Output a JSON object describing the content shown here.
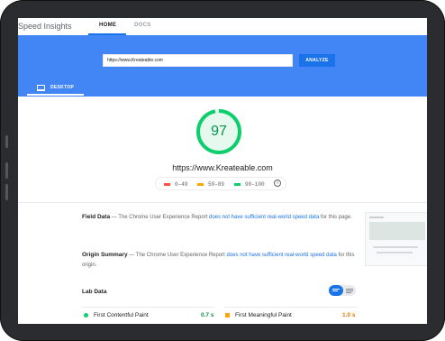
{
  "header": {
    "brand": "Speed Insights",
    "tabs": [
      {
        "label": "HOME"
      },
      {
        "label": "DOCS"
      }
    ]
  },
  "search": {
    "url_value": "https://www.Kreateable.com",
    "analyze_label": "ANALYZE"
  },
  "device_tab": {
    "label": "DESKTOP"
  },
  "score": {
    "value": "97",
    "fraction": 0.97,
    "site_url": "https://www.Kreateable.com"
  },
  "legend": [
    {
      "range": "0–49",
      "color": "#ff4e42"
    },
    {
      "range": "50–89",
      "color": "#ffa400"
    },
    {
      "range": "90–100",
      "color": "#0cce6b"
    }
  ],
  "field_data": {
    "title": "Field Data",
    "text_before": " — The Chrome User Experience Report ",
    "link": "does not have sufficient real-world speed data",
    "text_after": " for this page."
  },
  "origin_summary": {
    "title": "Origin Summary",
    "text_before": " — The Chrome User Experience Report ",
    "link": "does not have sufficient real-world speed data",
    "text_after": " for this origin."
  },
  "lab_data": {
    "title": "Lab Data",
    "metrics": [
      {
        "label": "First Contentful Paint",
        "value": "0.7 s",
        "color": "#0cce6b"
      },
      {
        "label": "First Meaningful Paint",
        "value": "1.0 s",
        "color": "#ffa400"
      }
    ]
  },
  "colors": {
    "accent": "#4285f4",
    "button": "#1a73e8",
    "good": "#0cce6b",
    "good_text": "#0d904f",
    "average": "#ffa400",
    "poor": "#ff4e42"
  }
}
